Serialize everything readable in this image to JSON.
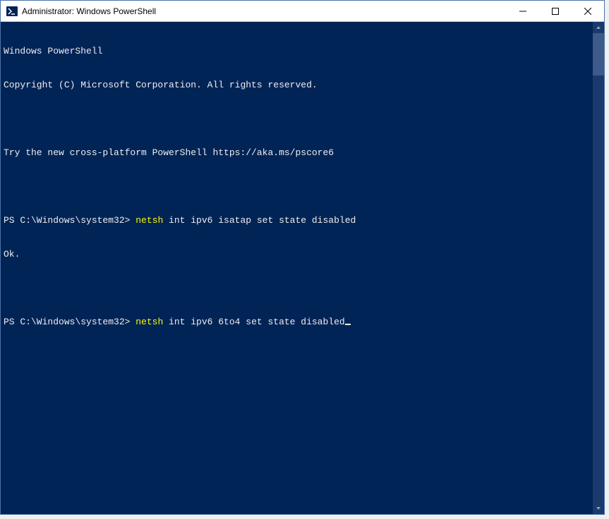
{
  "window": {
    "title": "Administrator: Windows PowerShell"
  },
  "terminal": {
    "banner1": "Windows PowerShell",
    "banner2": "Copyright (C) Microsoft Corporation. All rights reserved.",
    "banner3": "Try the new cross-platform PowerShell https://aka.ms/pscore6",
    "prompt1_prefix": "PS C:\\Windows\\system32> ",
    "cmd1_highlight": "netsh ",
    "cmd1_rest": "int ipv6 isatap set state disabled",
    "result1": "Ok.",
    "prompt2_prefix": "PS C:\\Windows\\system32> ",
    "cmd2_highlight": "netsh ",
    "cmd2_rest": "int ipv6 6to4 set state disabled"
  }
}
